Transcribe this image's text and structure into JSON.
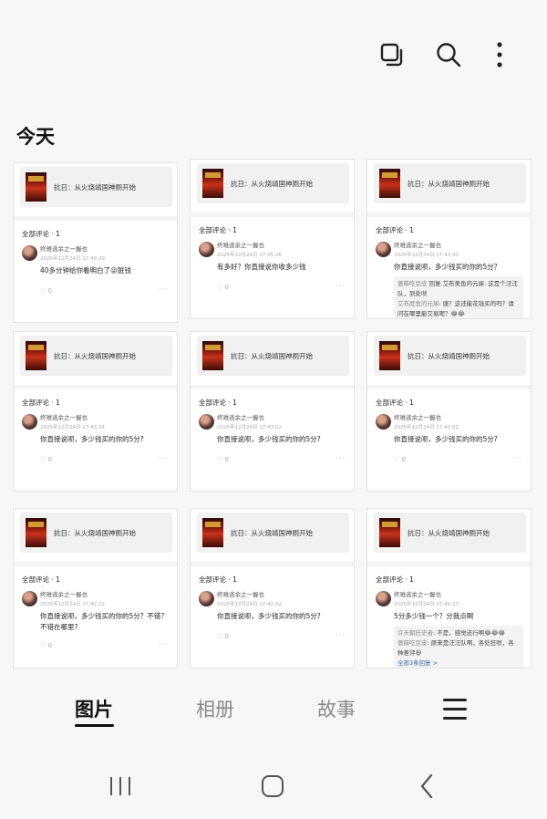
{
  "header": {
    "icons": [
      "select-icon",
      "search-icon",
      "more-options-icon"
    ]
  },
  "section": {
    "title": "今天"
  },
  "thumbnails": [
    {
      "post_title": "抗日：从火烧靖国神厕开始",
      "comment_count": "全部评论 · 1",
      "user": "终难逃余之一握也",
      "time": "2025年12月24日 17:49:29",
      "comment": "40多分钟给你看明白了😜脏钱",
      "likes": "0",
      "replies": []
    },
    {
      "post_title": "抗日：从火烧靖国神厕开始",
      "comment_count": "全部评论 · 1",
      "user": "终难逃余之一握也",
      "time": "2025年12月24日 17:45:26",
      "comment": "有多好？你直接说你收多少钱",
      "likes": "0",
      "replies": []
    },
    {
      "post_title": "抗日：从火烧靖国神厕开始",
      "comment_count": "全部评论 · 1",
      "user": "终难逃余之一握也",
      "time": "2025年12月24日 17:43:43",
      "comment": "你直接说呗，多少钱买的你的5分？",
      "likes": "0",
      "replies": [
        {
          "name": "蔷薇吃豆皮",
          "text": " 回复 艾布奥鱼的元屎: 这是个汪汪队，到处吠"
        },
        {
          "name": "艾布度鱼的元屎",
          "text": ": 唐？这还能花钱买的吗？请问在哪里能交易呢？😂😂"
        }
      ],
      "more_replies": ""
    },
    {
      "post_title": "抗日：从火烧靖国神厕开始",
      "comment_count": "全部评论 · 1",
      "user": "终难逃余之一握也",
      "time": "2025年12月24日 17:43:34",
      "comment": "你直接说呗，多少钱买的你的5分?",
      "likes": "0",
      "replies": []
    },
    {
      "post_title": "抗日：从火烧靖国神厕开始",
      "comment_count": "全部评论 · 1",
      "user": "终难逃余之一握也",
      "time": "2025年12月24日 17:43:02",
      "comment": "你直接说呗，多少钱买的你的5分?",
      "likes": "0",
      "replies": []
    },
    {
      "post_title": "抗日：从火烧靖国神厕开始",
      "comment_count": "全部评论 · 1",
      "user": "终难逃余之一握也",
      "time": "2025年12月24日 17:43:02",
      "comment": "你直接说呗，多少钱买的你的5分?",
      "likes": "0",
      "replies": []
    },
    {
      "post_title": "抗日：从火烧靖国神厕开始",
      "comment_count": "全部评论 · 1",
      "user": "终难逃余之一握也",
      "time": "2025年12月24日 17:42:22",
      "comment": "你直接说呗，多少钱买的你的5分？不错？不错在哪里?",
      "likes": "0",
      "replies": []
    },
    {
      "post_title": "抗日：从火烧靖国神厕开始",
      "comment_count": "全部评论 · 1",
      "user": "终难逃余之一握也",
      "time": "2025年12月24日 17:42:02",
      "comment": "你直接说呗，多少钱买的你的5分?",
      "likes": "0",
      "replies": []
    },
    {
      "post_title": "抗日：从火烧靖国神厕开始",
      "comment_count": "全部评论 · 1",
      "user": "终难逃余之一握也",
      "time": "2025年12月24日 17:40:27",
      "comment": "5分多少钱一个？分我点啊",
      "likes": "0",
      "replies": [
        {
          "name": "许天朝历史者",
          "text": ": 不是，感觉还行啊😂😂😂"
        },
        {
          "name": "蔷薇吃豆皮",
          "text": ": 原来是汪汪队啊，各处狂吠，各种差评😆"
        }
      ],
      "more_replies": "全部3条回复 >"
    }
  ],
  "tabs": {
    "items": [
      "图片",
      "相册",
      "故事"
    ],
    "active": "图片",
    "menu_icon": "hamburger-menu-icon"
  },
  "navbar": {
    "icons": [
      "recent-apps-icon",
      "home-icon",
      "back-icon"
    ]
  },
  "colors": {
    "background": "#f7f7f7",
    "active_tab": "#111111",
    "inactive_tab": "#8a8a8a",
    "link": "#3a6fb0"
  }
}
